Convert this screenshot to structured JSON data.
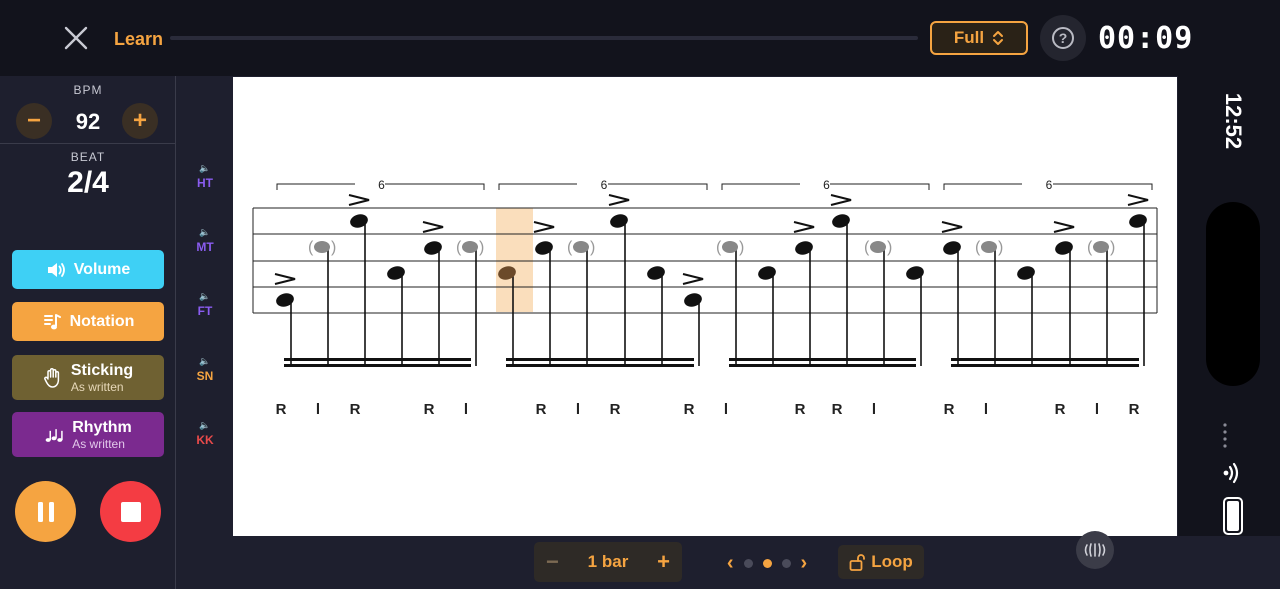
{
  "header": {
    "learn_label": "Learn",
    "mode_label": "Full",
    "help_label": "?",
    "timer": "00:09"
  },
  "tempo": {
    "bpm_label": "BPM",
    "bpm_value": "92",
    "minus": "−",
    "plus": "+",
    "beat_label": "BEAT",
    "beat_value": "2/4"
  },
  "menu": {
    "volume": "Volume",
    "notation": "Notation",
    "sticking": "Sticking",
    "sticking_sub": "As written",
    "rhythm": "Rhythm",
    "rhythm_sub": "As written"
  },
  "instruments": [
    "HT",
    "MT",
    "FT",
    "SN",
    "KK"
  ],
  "instrument_colors": [
    "#8a5cf0",
    "#8a5cf0",
    "#8a5cf0",
    "#f5a441",
    "#e84a4a"
  ],
  "score": {
    "tuplet_label": "6",
    "tuplets": [
      "6",
      "6",
      "6",
      "6"
    ],
    "sticking": [
      "R",
      "l",
      "R",
      "R",
      "l",
      "R",
      "l",
      "R",
      "R",
      "l",
      "R",
      "R",
      "l",
      "R",
      "l",
      "R",
      "l",
      "R"
    ]
  },
  "status": {
    "clock": "12:52"
  },
  "footer": {
    "bar_minus": "−",
    "bar_label": "1 bar",
    "bar_plus": "+",
    "prev": "‹",
    "next": "›",
    "loop_label": "Loop"
  },
  "colors": {
    "accent": "#f5a441",
    "stop": "#f43c43",
    "volume": "#3ed0f5",
    "sticking": "#6f6132",
    "rhythm": "#7b2a8f"
  }
}
